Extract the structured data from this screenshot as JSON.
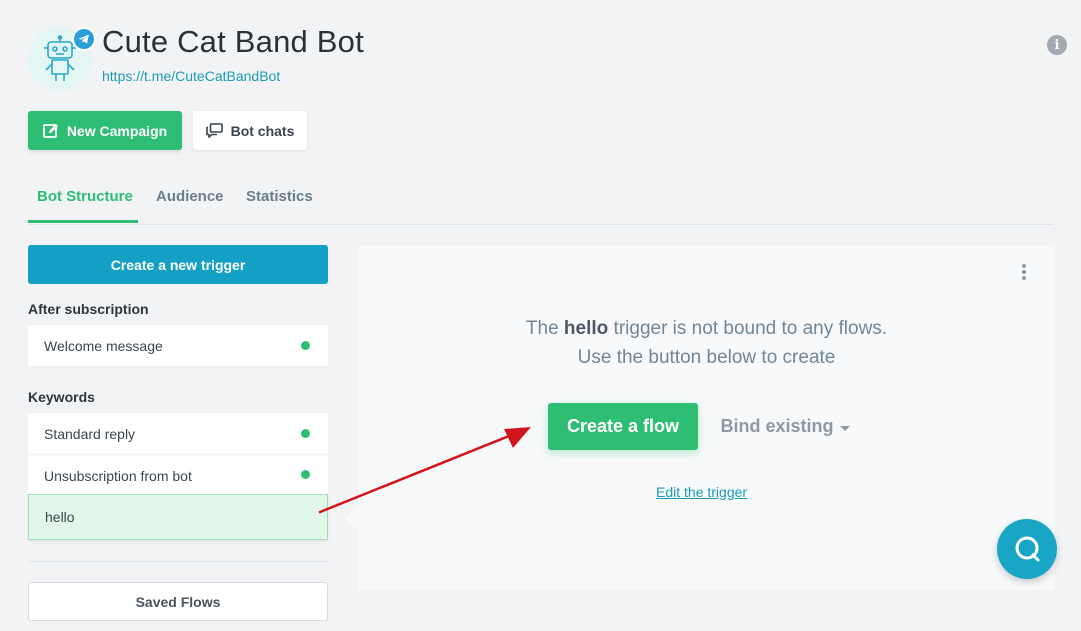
{
  "header": {
    "title": "Cute Cat Band Bot",
    "link": "https://t.me/CuteCatBandBot",
    "avatar_icon": "robot-icon",
    "badge_icon": "telegram-icon"
  },
  "actions": {
    "new_campaign_label": "New Campaign",
    "bot_chats_label": "Bot chats"
  },
  "tabs": [
    {
      "label": "Bot Structure",
      "active": true
    },
    {
      "label": "Audience",
      "active": false
    },
    {
      "label": "Statistics",
      "active": false
    }
  ],
  "sidebar": {
    "create_trigger_label": "Create a new trigger",
    "after_subscription_label": "After subscription",
    "after_subscription_items": [
      {
        "label": "Welcome message",
        "active": true
      }
    ],
    "keywords_label": "Keywords",
    "keyword_items": [
      {
        "label": "Standard reply",
        "active": true
      },
      {
        "label": "Unsubscription from bot",
        "active": true
      },
      {
        "label": "hello",
        "active": false,
        "selected": true
      }
    ],
    "saved_flows_label": "Saved Flows"
  },
  "main": {
    "message_prefix": "The",
    "trigger_name": "hello",
    "message_suffix": "trigger is not bound to any flows.",
    "message_line2": "Use the button below to create",
    "create_flow_label": "Create a flow",
    "bind_existing_label": "Bind existing",
    "edit_trigger_label": "Edit the trigger"
  },
  "colors": {
    "accent_green": "#2ebe73",
    "accent_blue": "#13a0c4",
    "annotation_red": "#d0161b"
  }
}
